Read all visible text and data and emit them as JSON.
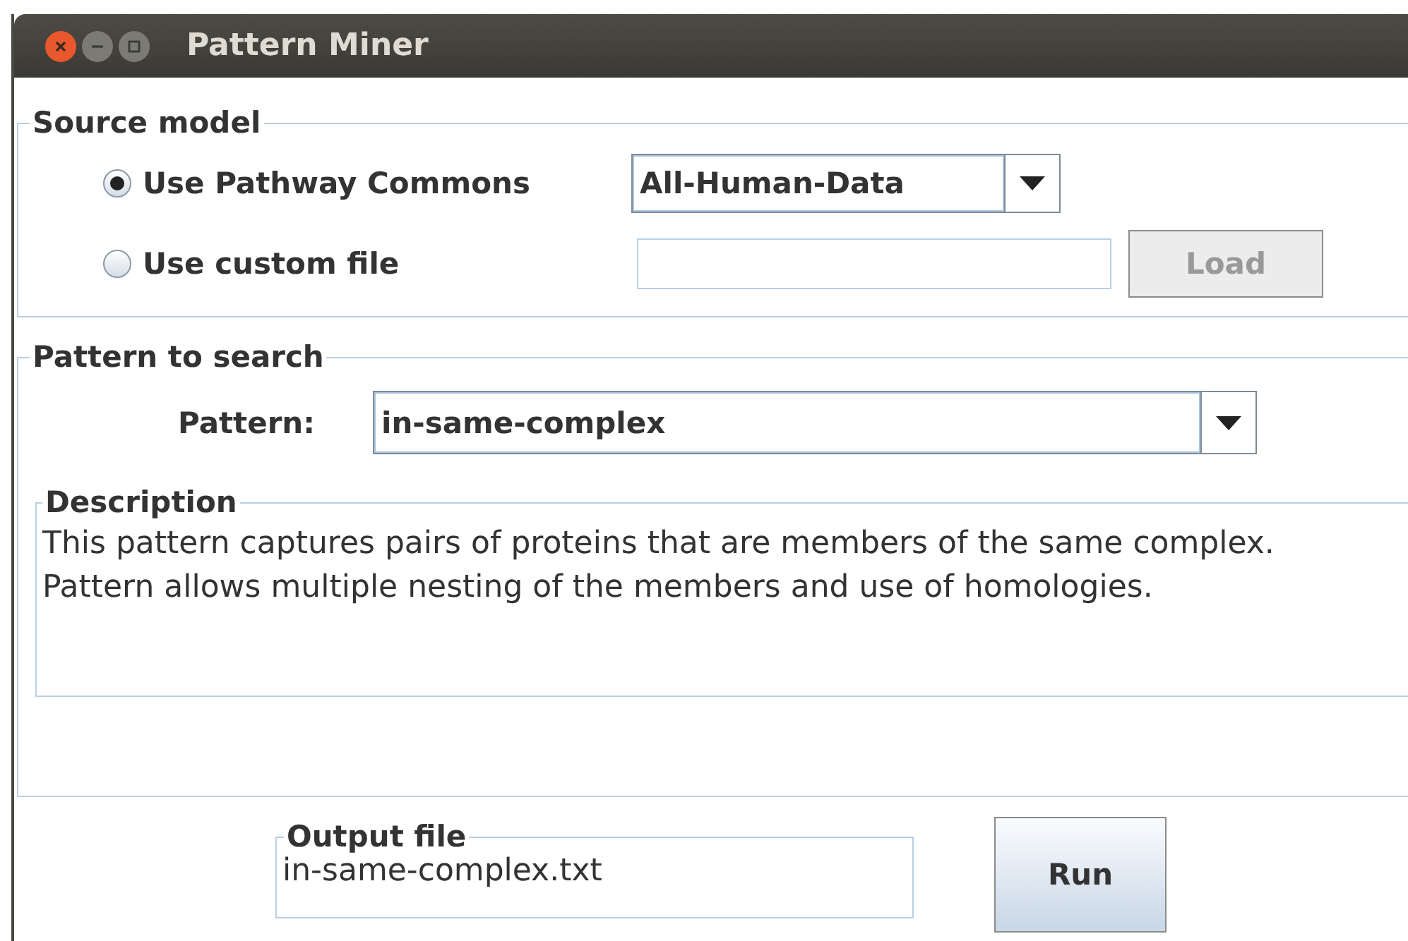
{
  "window": {
    "title": "Pattern Miner"
  },
  "source_model": {
    "title": "Source model",
    "options": [
      {
        "label": "Use Pathway Commons",
        "selected": true
      },
      {
        "label": "Use custom file",
        "selected": false
      }
    ],
    "dataset": {
      "value": "All-Human-Data"
    },
    "load_button": {
      "label": "Load",
      "disabled": true
    }
  },
  "pattern_search": {
    "title": "Pattern to search",
    "pattern_label": "Pattern:",
    "pattern": {
      "value": "in-same-complex"
    },
    "description": {
      "title": "Description",
      "text": "This pattern captures pairs of proteins that are members of the same complex. Pattern allows multiple nesting of the members and use of homologies."
    }
  },
  "output": {
    "title": "Output file",
    "value": "in-same-complex.txt"
  },
  "run_button": {
    "label": "Run"
  }
}
